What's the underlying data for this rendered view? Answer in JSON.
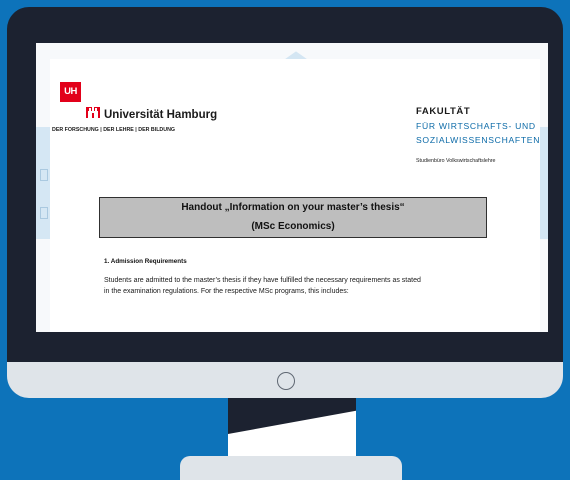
{
  "document": {
    "logo": {
      "mark": "UH",
      "name": "Universität Hamburg",
      "tagline": "DER FORSCHUNG | DER LEHRE | DER BILDUNG"
    },
    "faculty": {
      "title": "FAKULTÄT",
      "line1": "FÜR WIRTSCHAFTS- UND",
      "line2": "SOZIALWISSENSCHAFTEN",
      "office": "Studienbüro Volkswirtschaftslehre"
    },
    "handout": {
      "title": "Handout „Information on your master’s thesis“",
      "subtitle": "(MSc Economics)"
    },
    "section": {
      "heading": "1.     Admission Requirements",
      "text_line1": "Students are admitted to the master’s thesis if they have fulfilled the necessary requirements as stated",
      "text_line2": "in the examination regulations. For the respective MSc programs, this includes:"
    }
  },
  "colors": {
    "background": "#0d73ba",
    "brand_red": "#e2001a",
    "faculty_blue": "#0d6ba8",
    "title_box": "#bebebe"
  }
}
